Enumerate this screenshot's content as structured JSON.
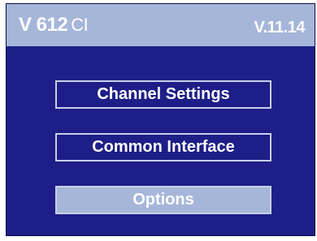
{
  "header": {
    "model": "V 612",
    "model_suffix": "CI",
    "version": "V.11.14"
  },
  "menu": {
    "items": [
      {
        "label": "Channel Settings",
        "selected": false
      },
      {
        "label": "Common Interface",
        "selected": false
      },
      {
        "label": "Options",
        "selected": true
      }
    ]
  },
  "colors": {
    "background": "#1d1e87",
    "title_bar": "#a6b6d9",
    "selected_item": "#a6b6d9",
    "text": "#ffffff"
  }
}
